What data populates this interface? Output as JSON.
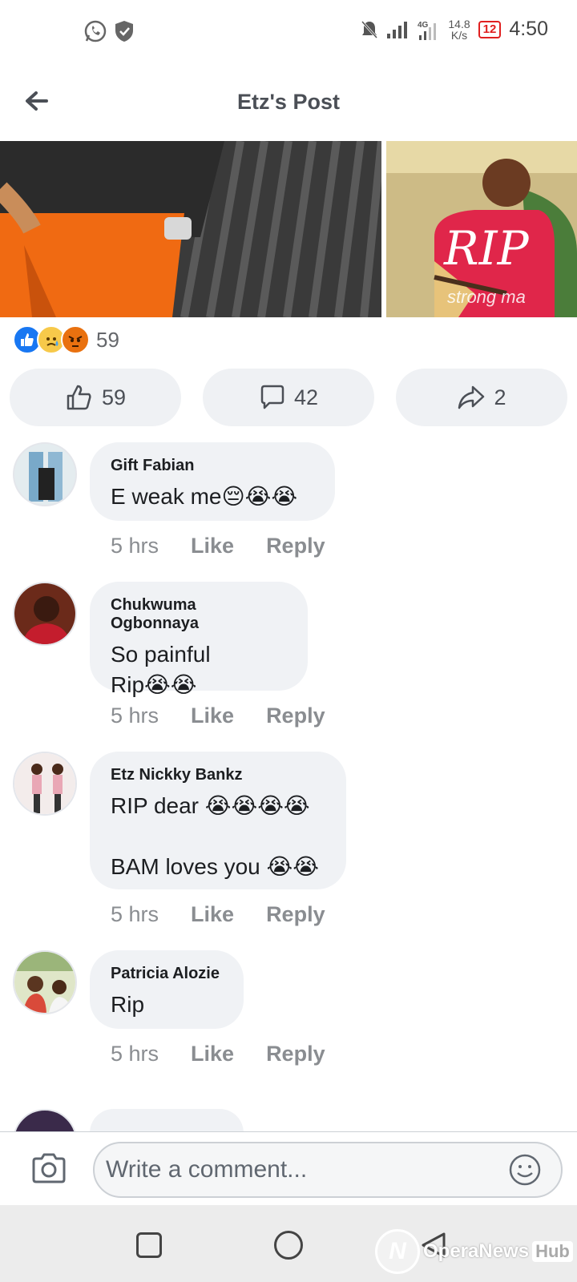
{
  "status_bar": {
    "net_speed_value": "14.8",
    "net_speed_unit": "K/s",
    "network_type": "4G",
    "battery": "12",
    "time": "4:50"
  },
  "header": {
    "title": "Etz's Post"
  },
  "photo": {
    "overlay_text": "RIP",
    "caption_text": "strong ma"
  },
  "reactions": {
    "count": "59"
  },
  "actions": {
    "like_count": "59",
    "comment_count": "42",
    "share_count": "2"
  },
  "comments": [
    {
      "name": "Gift Fabian",
      "text": " E weak me😔😭😭",
      "time": "5 hrs",
      "like": "Like",
      "reply": "Reply"
    },
    {
      "name": "Chukwuma Ogbonnaya",
      "text": "So painful\nRip😭😭",
      "time": "5 hrs",
      "like": "Like",
      "reply": "Reply"
    },
    {
      "name": "Etz Nickky Bankz",
      "text": "RIP dear 😭😭😭😭\n\nBAM loves you 😭😭",
      "time": "5 hrs",
      "like": "Like",
      "reply": "Reply"
    },
    {
      "name": "Patricia Alozie",
      "text": "Rip",
      "time": "5 hrs",
      "like": "Like",
      "reply": "Reply"
    }
  ],
  "comment_box": {
    "placeholder": "Write a comment..."
  },
  "watermark": {
    "brand": "OperaNews",
    "hub": "Hub"
  },
  "colors": {
    "like_blue": "#1877f2",
    "bubble_bg": "#f0f2f5",
    "meta_gray": "#8a8d91",
    "battery_red": "#e02020"
  }
}
